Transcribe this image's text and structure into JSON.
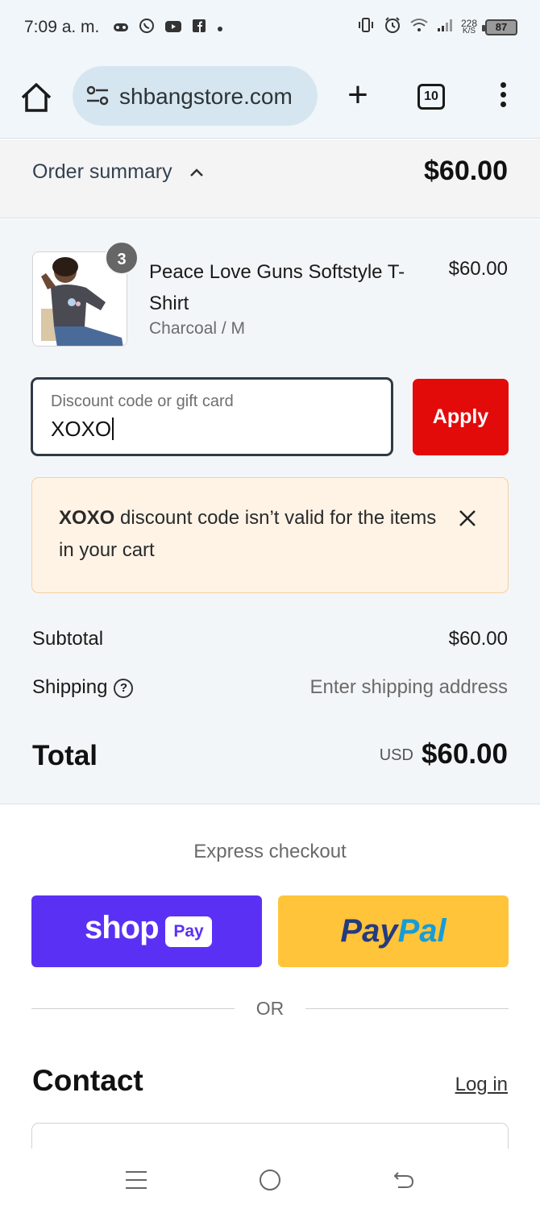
{
  "status_bar": {
    "time": "7:09 a. m.",
    "net_speed_value": "228",
    "net_speed_unit": "K/S",
    "battery": "87",
    "left_icons": [
      "game-controller-icon",
      "whatsapp-icon",
      "youtube-icon",
      "facebook-icon",
      "dot-icon"
    ],
    "right_icons": [
      "vibrate-icon",
      "alarm-icon",
      "wifi-icon",
      "signal-icon",
      "battery-icon"
    ]
  },
  "browser": {
    "url": "shbangstore.com",
    "tab_count": "10",
    "icons": [
      "home-icon",
      "site-settings-icon",
      "new-tab-icon",
      "tabs-icon",
      "more-menu-icon"
    ]
  },
  "order_summary": {
    "label": "Order summary",
    "total": "$60.00"
  },
  "product": {
    "name": "Peace Love Guns Softstyle T-Shirt",
    "variant": "Charcoal / M",
    "price": "$60.00",
    "quantity": "3"
  },
  "discount": {
    "placeholder": "Discount code or gift card",
    "value": "XOXO",
    "apply_label": "Apply"
  },
  "alert": {
    "code": "XOXO",
    "message": " discount code isn’t valid for the items in your cart"
  },
  "totals": {
    "subtotal_label": "Subtotal",
    "subtotal_value": "$60.00",
    "shipping_label": "Shipping",
    "shipping_value": "Enter shipping address",
    "total_label": "Total",
    "currency": "USD",
    "total_value": "$60.00"
  },
  "express": {
    "title": "Express checkout",
    "shop_pay_shop": "shop",
    "shop_pay_pay": "Pay",
    "paypal_part1": "Pay",
    "paypal_part2": "Pal",
    "or_label": "OR"
  },
  "contact": {
    "title": "Contact",
    "login_label": "Log in"
  },
  "colors": {
    "apply_button": "#e30a0a",
    "shop_pay": "#5a31f4",
    "paypal": "#ffc439",
    "alert_bg": "#fff3e6"
  }
}
